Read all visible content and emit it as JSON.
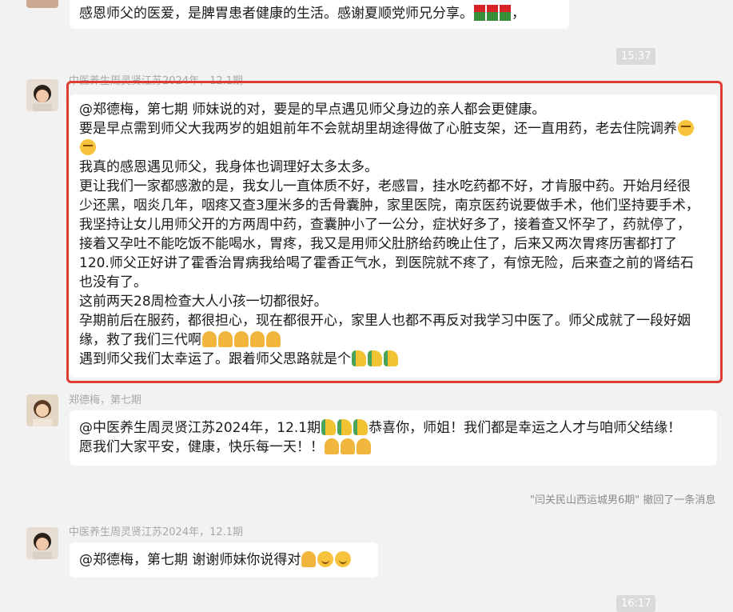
{
  "messages": [
    {
      "id": "m0",
      "lines": [
        "感恩师父的医爱，是脾胃患者健康的生活。感谢夏顺党师兄分享。"
      ],
      "emoji": [
        "rose",
        "rose",
        "rose"
      ],
      "tail": "，"
    },
    {
      "id": "m1",
      "sender": "中医养生周灵贤江苏2024年，12.1期",
      "lines": [
        "@郑德梅，第七期 师妹说的对，要是的早点遇见师父身边的亲人都会更健康。",
        "要是早点需到师父大我两岁的姐姐前年不会就胡里胡途得做了心脏支架，还一直用药，老去住院调养",
        "我真的感恩遇见师父，我身体也调理好太多太多。",
        "更让我们一家都感激的是，我女儿一直体质不好，老感冒，挂水吃药都不好，才肯服中药。开始月经很",
        "少还黑，咽炎几年，咽疼又查3厘米多的舌骨囊肿，家里医院，南京医药说要做手术，他们坚持要手术，",
        "我坚持让女儿用师父开的方两周中药，查囊肿小了一公分，症状好多了，接着查又怀孕了，药就停了，",
        "接着又孕吐不能吃饭不能喝水，胃疼，我又是用师父肚脐给药晚止住了，后来又两次胃疼历害都打了",
        "120.师父正好讲了霍香治胃病我给喝了霍香正气水，到医院就不疼了，有惊无险，后来查之前的肾结石",
        "也没有了。",
        "这前两天28周检查大人小孩一切都很好。",
        "孕期前后在服药，都很担心，现在都很开心，家里人也都不再反对我学习中医了。师父成就了一段好姻",
        "缘，救了我们三代啊",
        "遇到师父我们太幸运了。跟着师父思路就是个"
      ]
    },
    {
      "id": "m2",
      "sender": "郑德梅，第七期",
      "lines": [
        "@中医养生周灵贤江苏2024年，12.1期",
        "恭喜你，师姐！我们都是幸运之人才与咱师父结缘！",
        "愿我们大家平安，健康，快乐每一天！！"
      ]
    },
    {
      "id": "m3",
      "sender": "中医养生周灵贤江苏2024年，12.1期",
      "lines": [
        "@郑德梅，第七期 谢谢师妹你说得对"
      ]
    }
  ],
  "timestamps": [
    "15:37",
    "16:17"
  ],
  "recall_notice": "\"闫关民山西运城男6期\" 撤回了一条消息"
}
